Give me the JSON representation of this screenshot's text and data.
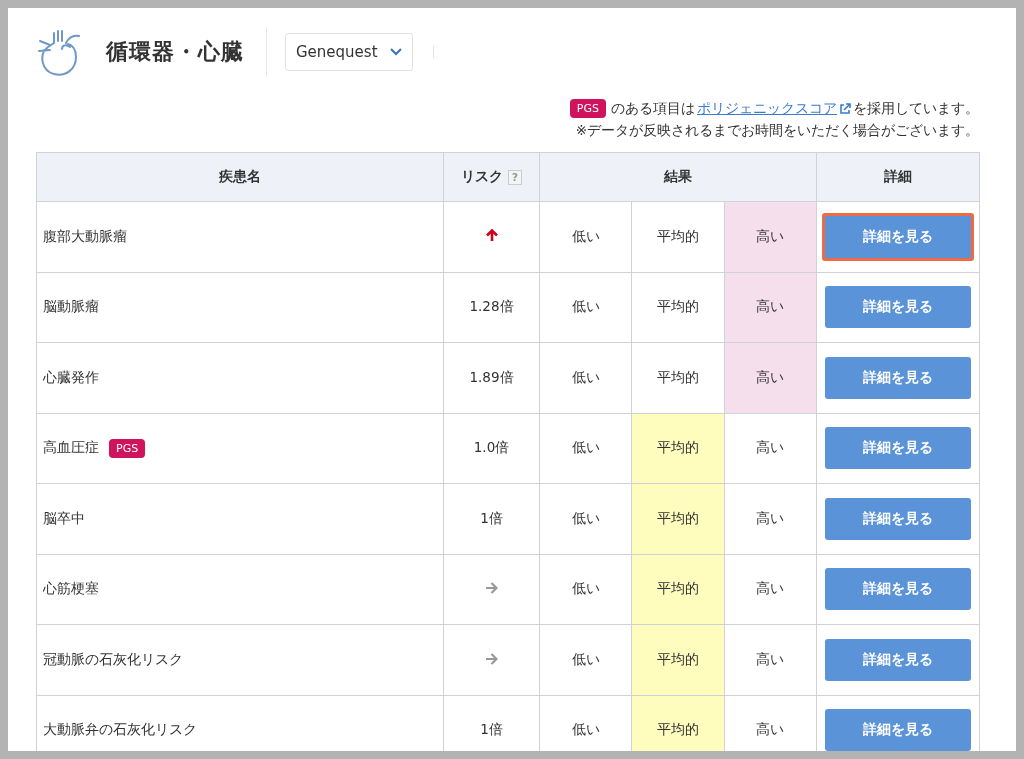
{
  "header": {
    "title": "循環器・心臓",
    "selector": {
      "value": "Genequest"
    }
  },
  "notice": {
    "badge": "PGS",
    "text_before": "のある項目は",
    "link": "ポリジェニックスコア",
    "text_after": "を採用しています。",
    "note": "※データが反映されるまでお時間をいただく場合がございます。"
  },
  "table": {
    "columns": {
      "name": "疾患名",
      "risk": "リスク",
      "risk_help": "?",
      "result": "結果",
      "detail": "詳細"
    },
    "rows": [
      {
        "name": "腹部大動脈瘤",
        "risk": {
          "kind": "up"
        },
        "results": [
          {
            "label": "低い",
            "selected": false
          },
          {
            "label": "平均的",
            "selected": false
          },
          {
            "label": "高い",
            "selected": true
          }
        ],
        "button": "詳細を見る",
        "focused": true
      },
      {
        "name": "脳動脈瘤",
        "risk": {
          "kind": "text",
          "text": "1.28倍"
        },
        "results": [
          {
            "label": "低い",
            "selected": false
          },
          {
            "label": "平均的",
            "selected": false
          },
          {
            "label": "高い",
            "selected": true
          }
        ],
        "button": "詳細を見る",
        "focused": false
      },
      {
        "name": "心臓発作",
        "risk": {
          "kind": "text",
          "text": "1.89倍"
        },
        "results": [
          {
            "label": "低い",
            "selected": false
          },
          {
            "label": "平均的",
            "selected": false
          },
          {
            "label": "高い",
            "selected": true
          }
        ],
        "button": "詳細を見る",
        "focused": false
      },
      {
        "name": "高血圧症",
        "badge": "PGS",
        "risk": {
          "kind": "text",
          "text": "1.0倍"
        },
        "results": [
          {
            "label": "低い",
            "selected": false
          },
          {
            "label": "平均的",
            "selected": true
          },
          {
            "label": "高い",
            "selected": false
          }
        ],
        "button": "詳細を見る",
        "focused": false
      },
      {
        "name": "脳卒中",
        "risk": {
          "kind": "text",
          "text": "1倍"
        },
        "results": [
          {
            "label": "低い",
            "selected": false
          },
          {
            "label": "平均的",
            "selected": true
          },
          {
            "label": "高い",
            "selected": false
          }
        ],
        "button": "詳細を見る",
        "focused": false
      },
      {
        "name": "心筋梗塞",
        "risk": {
          "kind": "flat"
        },
        "results": [
          {
            "label": "低い",
            "selected": false
          },
          {
            "label": "平均的",
            "selected": true
          },
          {
            "label": "高い",
            "selected": false
          }
        ],
        "button": "詳細を見る",
        "focused": false
      },
      {
        "name": "冠動脈の石灰化リスク",
        "risk": {
          "kind": "flat"
        },
        "results": [
          {
            "label": "低い",
            "selected": false
          },
          {
            "label": "平均的",
            "selected": true
          },
          {
            "label": "高い",
            "selected": false
          }
        ],
        "button": "詳細を見る",
        "focused": false
      },
      {
        "name": "大動脈弁の石灰化リスク",
        "risk": {
          "kind": "text",
          "text": "1倍"
        },
        "results": [
          {
            "label": "低い",
            "selected": false
          },
          {
            "label": "平均的",
            "selected": true
          },
          {
            "label": "高い",
            "selected": false
          }
        ],
        "button": "詳細を見る",
        "focused": false
      }
    ]
  }
}
